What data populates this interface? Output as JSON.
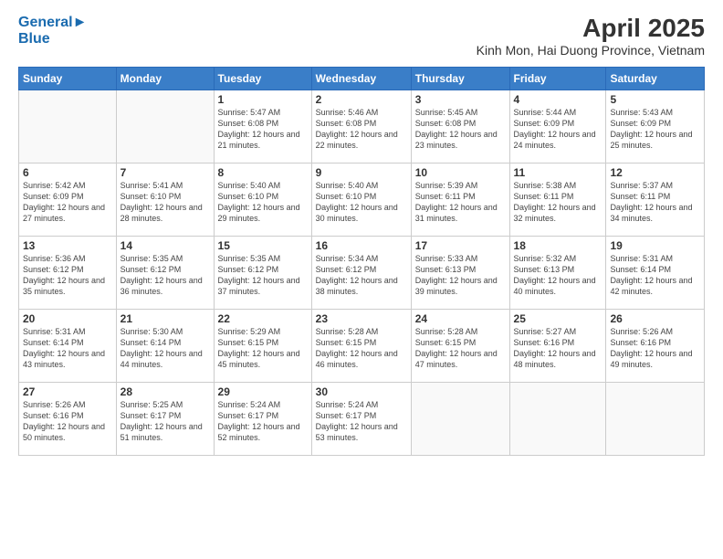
{
  "header": {
    "logo_line1": "General",
    "logo_line2": "Blue",
    "title": "April 2025",
    "subtitle": "Kinh Mon, Hai Duong Province, Vietnam"
  },
  "days_of_week": [
    "Sunday",
    "Monday",
    "Tuesday",
    "Wednesday",
    "Thursday",
    "Friday",
    "Saturday"
  ],
  "weeks": [
    [
      {
        "day": "",
        "sunrise": "",
        "sunset": "",
        "daylight": ""
      },
      {
        "day": "",
        "sunrise": "",
        "sunset": "",
        "daylight": ""
      },
      {
        "day": "1",
        "sunrise": "Sunrise: 5:47 AM",
        "sunset": "Sunset: 6:08 PM",
        "daylight": "Daylight: 12 hours and 21 minutes."
      },
      {
        "day": "2",
        "sunrise": "Sunrise: 5:46 AM",
        "sunset": "Sunset: 6:08 PM",
        "daylight": "Daylight: 12 hours and 22 minutes."
      },
      {
        "day": "3",
        "sunrise": "Sunrise: 5:45 AM",
        "sunset": "Sunset: 6:08 PM",
        "daylight": "Daylight: 12 hours and 23 minutes."
      },
      {
        "day": "4",
        "sunrise": "Sunrise: 5:44 AM",
        "sunset": "Sunset: 6:09 PM",
        "daylight": "Daylight: 12 hours and 24 minutes."
      },
      {
        "day": "5",
        "sunrise": "Sunrise: 5:43 AM",
        "sunset": "Sunset: 6:09 PM",
        "daylight": "Daylight: 12 hours and 25 minutes."
      }
    ],
    [
      {
        "day": "6",
        "sunrise": "Sunrise: 5:42 AM",
        "sunset": "Sunset: 6:09 PM",
        "daylight": "Daylight: 12 hours and 27 minutes."
      },
      {
        "day": "7",
        "sunrise": "Sunrise: 5:41 AM",
        "sunset": "Sunset: 6:10 PM",
        "daylight": "Daylight: 12 hours and 28 minutes."
      },
      {
        "day": "8",
        "sunrise": "Sunrise: 5:40 AM",
        "sunset": "Sunset: 6:10 PM",
        "daylight": "Daylight: 12 hours and 29 minutes."
      },
      {
        "day": "9",
        "sunrise": "Sunrise: 5:40 AM",
        "sunset": "Sunset: 6:10 PM",
        "daylight": "Daylight: 12 hours and 30 minutes."
      },
      {
        "day": "10",
        "sunrise": "Sunrise: 5:39 AM",
        "sunset": "Sunset: 6:11 PM",
        "daylight": "Daylight: 12 hours and 31 minutes."
      },
      {
        "day": "11",
        "sunrise": "Sunrise: 5:38 AM",
        "sunset": "Sunset: 6:11 PM",
        "daylight": "Daylight: 12 hours and 32 minutes."
      },
      {
        "day": "12",
        "sunrise": "Sunrise: 5:37 AM",
        "sunset": "Sunset: 6:11 PM",
        "daylight": "Daylight: 12 hours and 34 minutes."
      }
    ],
    [
      {
        "day": "13",
        "sunrise": "Sunrise: 5:36 AM",
        "sunset": "Sunset: 6:12 PM",
        "daylight": "Daylight: 12 hours and 35 minutes."
      },
      {
        "day": "14",
        "sunrise": "Sunrise: 5:35 AM",
        "sunset": "Sunset: 6:12 PM",
        "daylight": "Daylight: 12 hours and 36 minutes."
      },
      {
        "day": "15",
        "sunrise": "Sunrise: 5:35 AM",
        "sunset": "Sunset: 6:12 PM",
        "daylight": "Daylight: 12 hours and 37 minutes."
      },
      {
        "day": "16",
        "sunrise": "Sunrise: 5:34 AM",
        "sunset": "Sunset: 6:12 PM",
        "daylight": "Daylight: 12 hours and 38 minutes."
      },
      {
        "day": "17",
        "sunrise": "Sunrise: 5:33 AM",
        "sunset": "Sunset: 6:13 PM",
        "daylight": "Daylight: 12 hours and 39 minutes."
      },
      {
        "day": "18",
        "sunrise": "Sunrise: 5:32 AM",
        "sunset": "Sunset: 6:13 PM",
        "daylight": "Daylight: 12 hours and 40 minutes."
      },
      {
        "day": "19",
        "sunrise": "Sunrise: 5:31 AM",
        "sunset": "Sunset: 6:14 PM",
        "daylight": "Daylight: 12 hours and 42 minutes."
      }
    ],
    [
      {
        "day": "20",
        "sunrise": "Sunrise: 5:31 AM",
        "sunset": "Sunset: 6:14 PM",
        "daylight": "Daylight: 12 hours and 43 minutes."
      },
      {
        "day": "21",
        "sunrise": "Sunrise: 5:30 AM",
        "sunset": "Sunset: 6:14 PM",
        "daylight": "Daylight: 12 hours and 44 minutes."
      },
      {
        "day": "22",
        "sunrise": "Sunrise: 5:29 AM",
        "sunset": "Sunset: 6:15 PM",
        "daylight": "Daylight: 12 hours and 45 minutes."
      },
      {
        "day": "23",
        "sunrise": "Sunrise: 5:28 AM",
        "sunset": "Sunset: 6:15 PM",
        "daylight": "Daylight: 12 hours and 46 minutes."
      },
      {
        "day": "24",
        "sunrise": "Sunrise: 5:28 AM",
        "sunset": "Sunset: 6:15 PM",
        "daylight": "Daylight: 12 hours and 47 minutes."
      },
      {
        "day": "25",
        "sunrise": "Sunrise: 5:27 AM",
        "sunset": "Sunset: 6:16 PM",
        "daylight": "Daylight: 12 hours and 48 minutes."
      },
      {
        "day": "26",
        "sunrise": "Sunrise: 5:26 AM",
        "sunset": "Sunset: 6:16 PM",
        "daylight": "Daylight: 12 hours and 49 minutes."
      }
    ],
    [
      {
        "day": "27",
        "sunrise": "Sunrise: 5:26 AM",
        "sunset": "Sunset: 6:16 PM",
        "daylight": "Daylight: 12 hours and 50 minutes."
      },
      {
        "day": "28",
        "sunrise": "Sunrise: 5:25 AM",
        "sunset": "Sunset: 6:17 PM",
        "daylight": "Daylight: 12 hours and 51 minutes."
      },
      {
        "day": "29",
        "sunrise": "Sunrise: 5:24 AM",
        "sunset": "Sunset: 6:17 PM",
        "daylight": "Daylight: 12 hours and 52 minutes."
      },
      {
        "day": "30",
        "sunrise": "Sunrise: 5:24 AM",
        "sunset": "Sunset: 6:17 PM",
        "daylight": "Daylight: 12 hours and 53 minutes."
      },
      {
        "day": "",
        "sunrise": "",
        "sunset": "",
        "daylight": ""
      },
      {
        "day": "",
        "sunrise": "",
        "sunset": "",
        "daylight": ""
      },
      {
        "day": "",
        "sunrise": "",
        "sunset": "",
        "daylight": ""
      }
    ]
  ]
}
